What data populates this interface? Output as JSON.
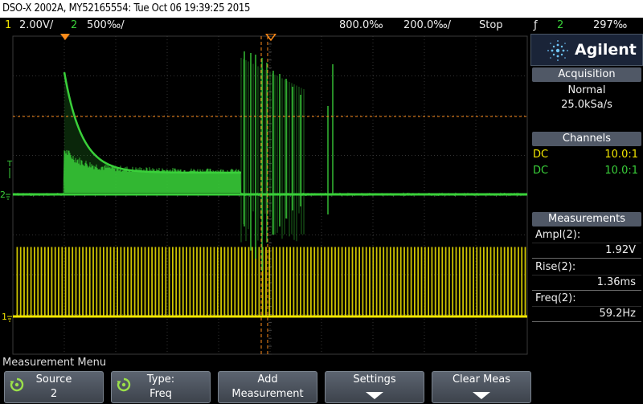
{
  "title_bar": {
    "text": "DSO-X 2002A, MY52165554: Tue Oct 06 19:39:25 2015"
  },
  "status": {
    "ch1_num": "1",
    "ch1_scale": "2.00V/",
    "ch2_num": "2",
    "ch2_scale": "500‰/",
    "time_scale": "800.0‰",
    "delay": "200.0‰/",
    "run_state": "Stop",
    "trigger_icon": "ƒ",
    "trigger_source": "2",
    "trigger_level": "297‰"
  },
  "screen": {
    "ch1_marker": "1",
    "ch2_marker": "2",
    "trigger_marker": "T",
    "ch1_color": "#f2e600",
    "ch2_color": "#3ad03a",
    "cursor_color": "#ff8c1a",
    "grid_color": "#333333"
  },
  "panel": {
    "brand": "Agilent",
    "acquisition_header": "Acquisition",
    "acq_mode": "Normal",
    "acq_rate": "25.0kSa/s",
    "channels_header": "Channels",
    "channels": [
      {
        "coupling": "DC",
        "probe": "10.0:1"
      },
      {
        "coupling": "DC",
        "probe": "10.0:1"
      }
    ],
    "measurements_header": "Measurements",
    "measurements": [
      {
        "label": "Ampl(2):",
        "value": "1.92V"
      },
      {
        "label": "Rise(2):",
        "value": "1.36ms"
      },
      {
        "label": "Freq(2):",
        "value": "59.2Hz"
      }
    ]
  },
  "menu": {
    "title": "Measurement Menu",
    "softkeys": [
      {
        "line1": "Source",
        "line2": "2"
      },
      {
        "line1": "Type:",
        "line2": "Freq"
      },
      {
        "line1": "Add",
        "line2": "Measurement"
      },
      {
        "line1": "Settings",
        "line2": ""
      },
      {
        "line1": "Clear Meas",
        "line2": ""
      }
    ]
  }
}
